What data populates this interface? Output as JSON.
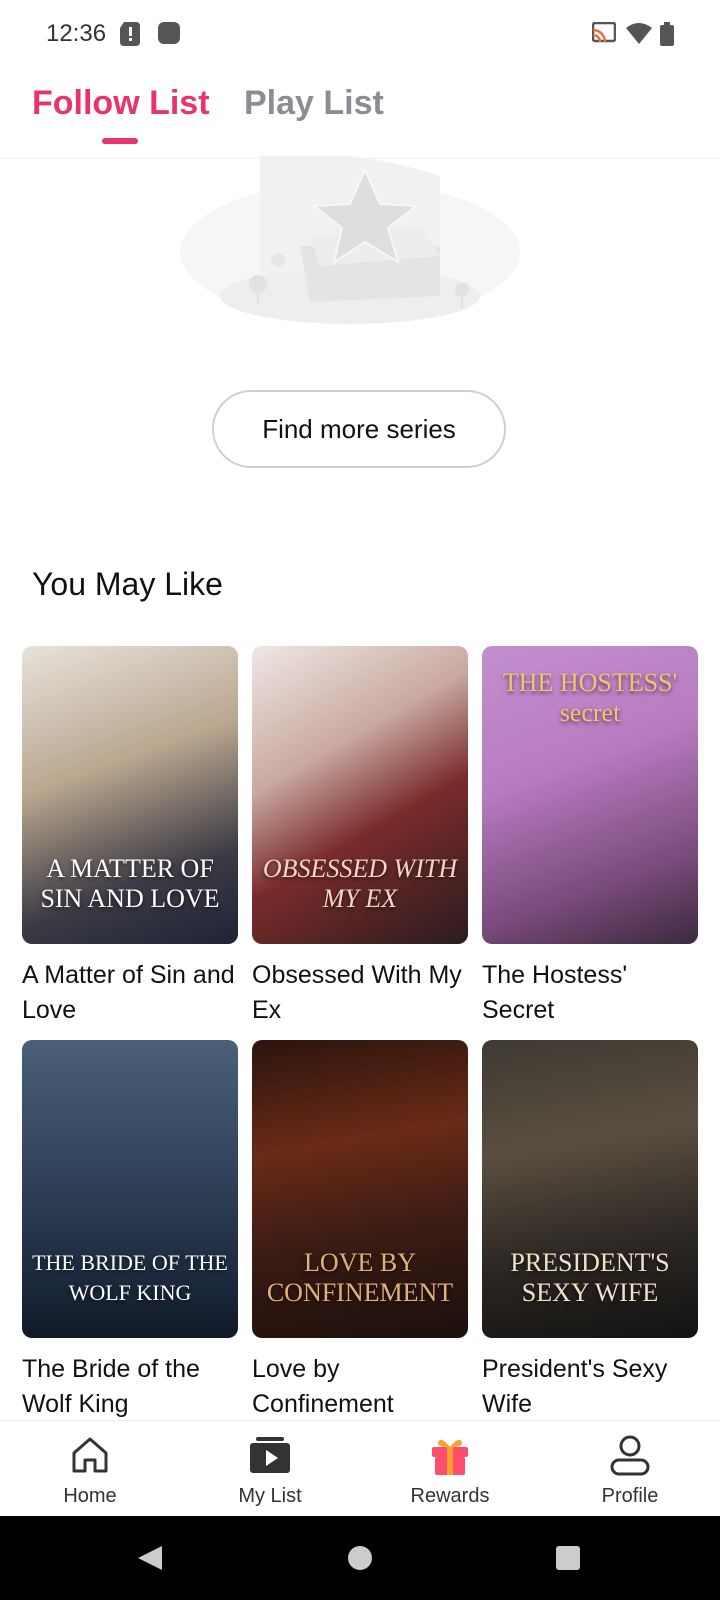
{
  "status_bar": {
    "time": "12:36",
    "left_icons": [
      "alert-card-icon",
      "record-icon"
    ],
    "right_icons": [
      "cast-icon",
      "wifi-icon",
      "battery-icon"
    ]
  },
  "tabs": [
    {
      "label": "Follow List",
      "active": true
    },
    {
      "label": "Play List",
      "active": false
    }
  ],
  "accent_color": "#e8336d",
  "empty_state": {
    "illustration": "empty-star-trophy-icon",
    "button_label": "Find more series"
  },
  "recommendations": {
    "title": "You May Like",
    "items": [
      {
        "title": "A Matter of Sin and Love",
        "cover_text": "A MATTER OF SIN AND LOVE"
      },
      {
        "title": "Obsessed With My Ex",
        "cover_text": "OBSESSED WITH MY EX"
      },
      {
        "title": "The Hostess' Secret",
        "cover_text": "THE HOSTESS' secret"
      },
      {
        "title": "The Bride of the Wolf King",
        "cover_text": "THE BRIDE OF THE WOLF KING"
      },
      {
        "title": "Love by Confinement",
        "cover_text": "LOVE BY CONFINEMENT"
      },
      {
        "title": "President's Sexy Wife",
        "cover_text": "PRESIDENT'S SEXY WIFE"
      }
    ]
  },
  "bottom_nav": [
    {
      "label": "Home",
      "icon": "home-icon"
    },
    {
      "label": "My List",
      "icon": "my-list-icon"
    },
    {
      "label": "Rewards",
      "icon": "gift-icon"
    },
    {
      "label": "Profile",
      "icon": "profile-icon"
    }
  ],
  "system_nav": [
    "back-icon",
    "home-circle-icon",
    "recents-icon"
  ]
}
